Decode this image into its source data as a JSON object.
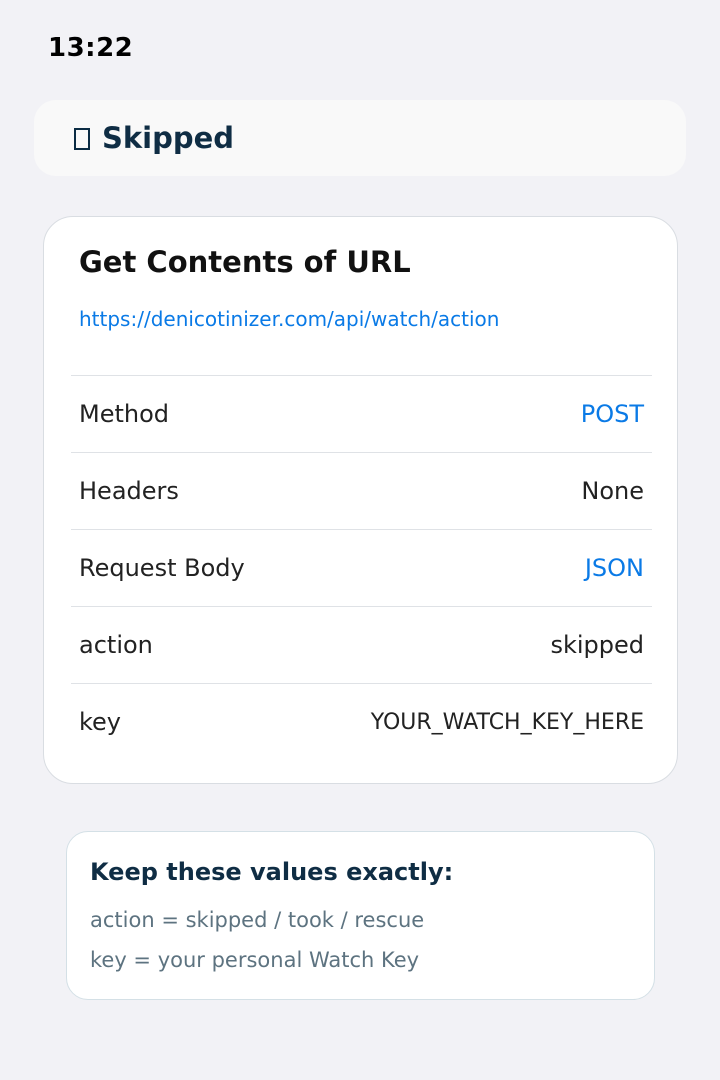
{
  "status_bar": {
    "time": "13:22"
  },
  "header": {
    "icon": "document-icon",
    "title": "Skipped"
  },
  "action": {
    "title": "Get Contents of URL",
    "url": "https://denicotinizer.com/api/watch/action",
    "params": [
      {
        "label": "Method",
        "value": "POST"
      },
      {
        "label": "Headers",
        "value": "None"
      },
      {
        "label": "Request Body",
        "value": "JSON"
      },
      {
        "label": "action",
        "value": "skipped"
      },
      {
        "label": "key",
        "value": "YOUR_WATCH_KEY_HERE"
      }
    ]
  },
  "note": {
    "title": "Keep these values exactly:",
    "lines": [
      "action = skipped / took / rescue",
      "key = your personal Watch Key"
    ]
  },
  "colors": {
    "background": "#f2f2f6",
    "accent": "#0a7ae6",
    "heading": "#0f2d44",
    "muted": "#5d7380"
  }
}
